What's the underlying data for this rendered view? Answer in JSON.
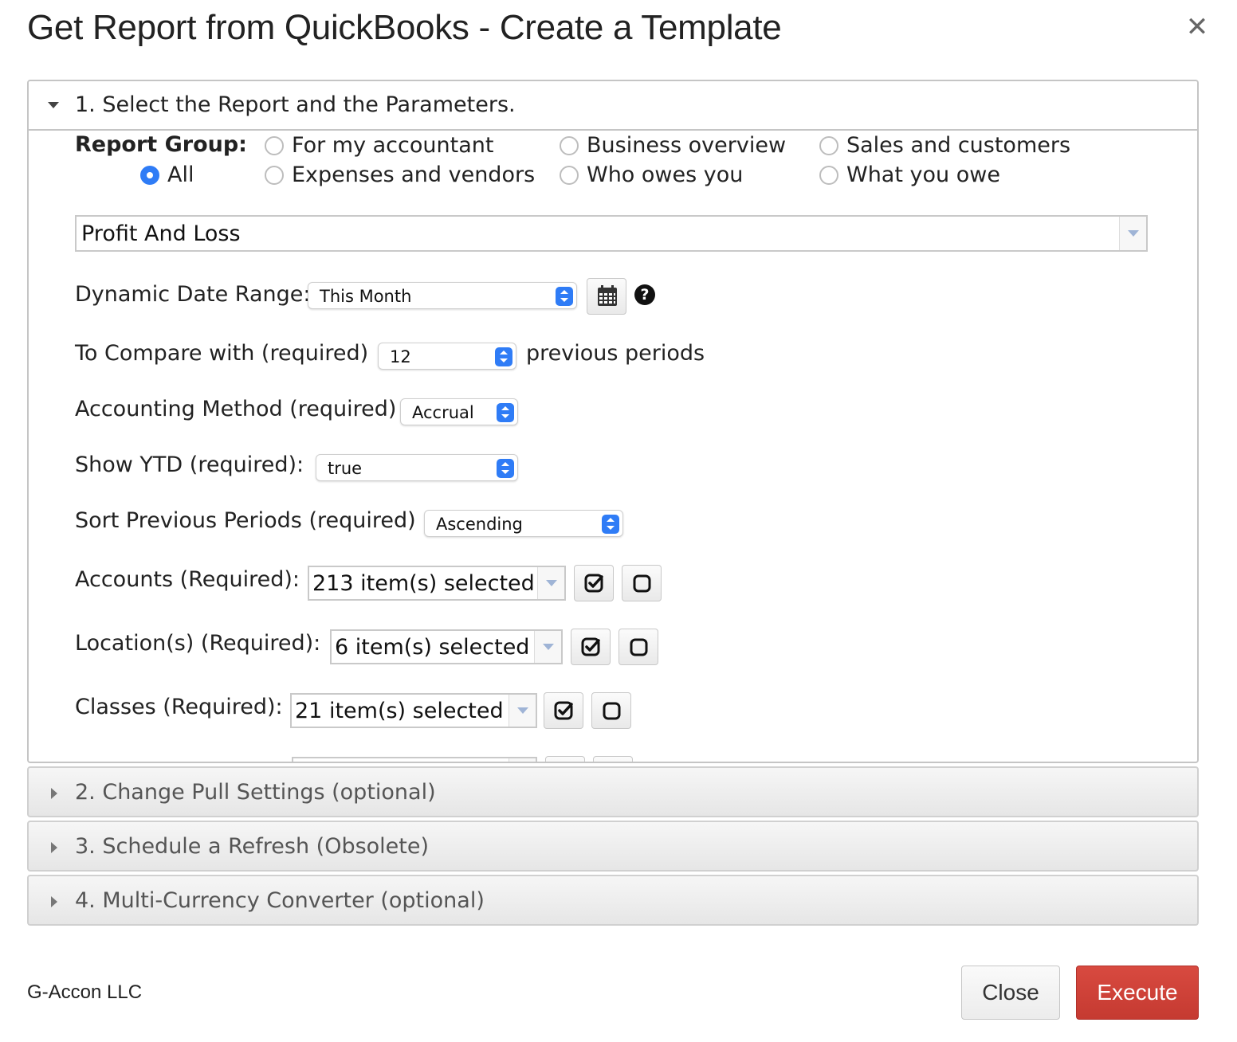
{
  "dialog": {
    "title": "Get Report from QuickBooks - Create a Template",
    "close_icon": "close-icon"
  },
  "sections": [
    {
      "label": "1. Select the Report and the Parameters.",
      "expanded": true
    },
    {
      "label": "2. Change Pull Settings (optional)",
      "expanded": false
    },
    {
      "label": "3. Schedule a Refresh (Obsolete)",
      "expanded": false
    },
    {
      "label": "4. Multi-Currency Converter (optional)",
      "expanded": false
    }
  ],
  "report_group": {
    "label": "Report Group:",
    "options": [
      {
        "label": "All",
        "selected": true
      },
      {
        "label": "For my accountant",
        "selected": false
      },
      {
        "label": "Expenses and vendors",
        "selected": false
      },
      {
        "label": "Business overview",
        "selected": false
      },
      {
        "label": "Who owes you",
        "selected": false
      },
      {
        "label": "Sales and customers",
        "selected": false
      },
      {
        "label": "What you owe",
        "selected": false
      }
    ]
  },
  "report": {
    "value": "Profit And Loss"
  },
  "params": {
    "date_range": {
      "label": "Dynamic Date Range:",
      "value": "This Month"
    },
    "compare": {
      "label": "To Compare with (required)",
      "value": "12",
      "suffix": "previous periods"
    },
    "accounting_method": {
      "label": "Accounting Method (required)",
      "value": "Accrual"
    },
    "show_ytd": {
      "label": "Show YTD (required):",
      "value": "true"
    },
    "sort_periods": {
      "label": "Sort Previous Periods (required)",
      "value": "Ascending"
    },
    "accounts": {
      "label": "Accounts (Required):",
      "value": "213 item(s) selected"
    },
    "locations": {
      "label": "Location(s) (Required):",
      "value": "6 item(s) selected"
    },
    "classes": {
      "label": "Classes (Required):",
      "value": "21 item(s) selected"
    }
  },
  "footer": {
    "brand": "G-Accon LLC",
    "close_label": "Close",
    "execute_label": "Execute"
  },
  "colors": {
    "accent": "#2f7cf6",
    "execute": "#c93d34"
  }
}
